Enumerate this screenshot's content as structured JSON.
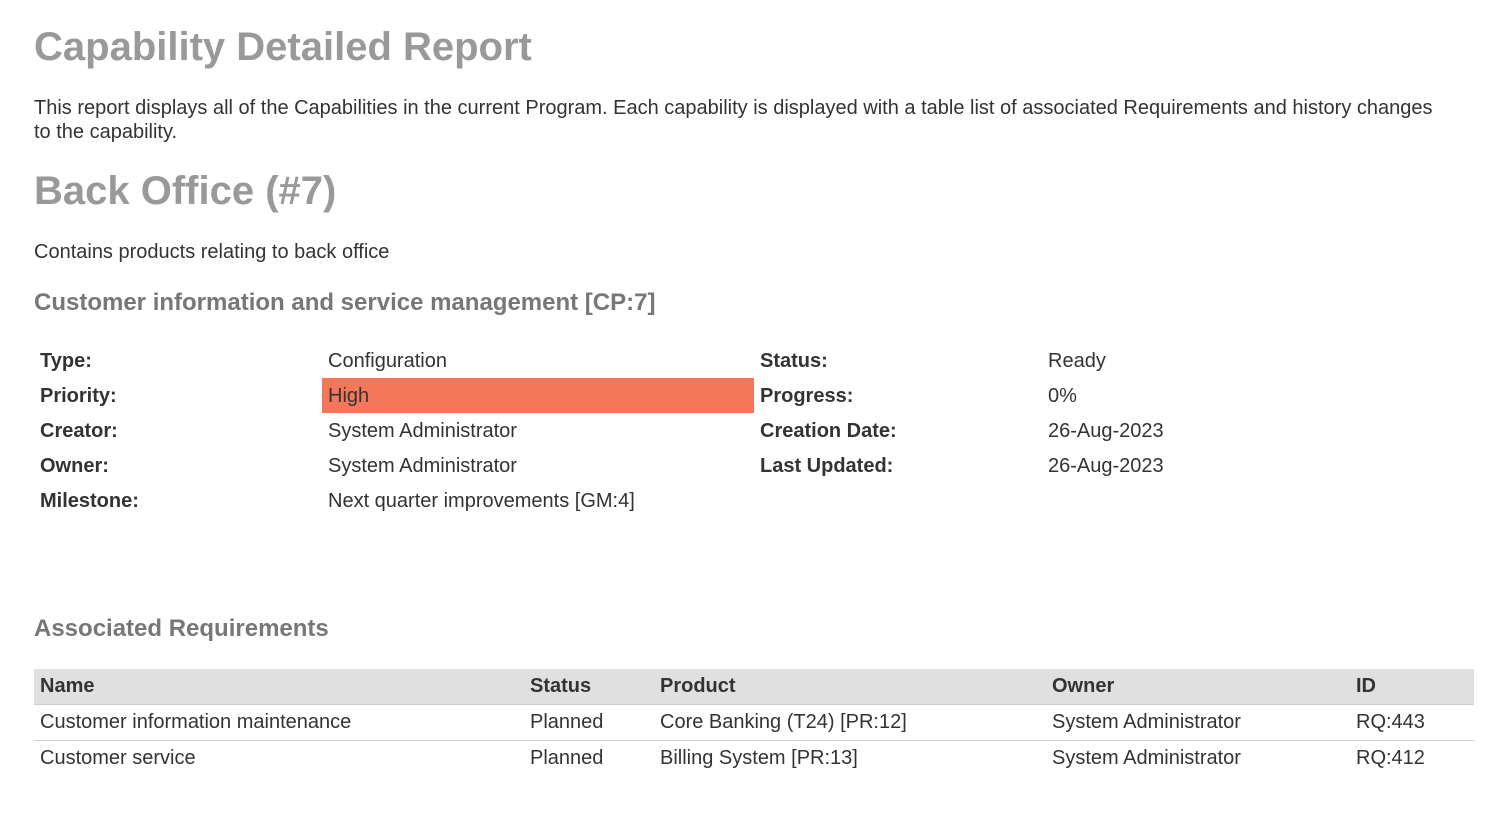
{
  "report": {
    "title": "Capability Detailed Report",
    "description": "This report displays all of the Capabilities in the current Program. Each capability is displayed with a table list of associated Requirements and history changes to the capability."
  },
  "folder": {
    "title": "Back Office (#7)",
    "description": "Contains products relating to back office"
  },
  "capability": {
    "title": "Customer information and service management [CP:7]",
    "properties": {
      "type_label": "Type:",
      "type_value": "Configuration",
      "status_label": "Status:",
      "status_value": "Ready",
      "priority_label": "Priority:",
      "priority_value": "High",
      "priority_color": "#f4775a",
      "progress_label": "Progress:",
      "progress_value": "0%",
      "creator_label": "Creator:",
      "creator_value": "System Administrator",
      "creation_date_label": "Creation Date:",
      "creation_date_value": "26-Aug-2023",
      "owner_label": "Owner:",
      "owner_value": "System Administrator",
      "last_updated_label": "Last Updated:",
      "last_updated_value": "26-Aug-2023",
      "milestone_label": "Milestone:",
      "milestone_value": "Next quarter improvements [GM:4]"
    }
  },
  "requirements": {
    "title": "Associated Requirements",
    "columns": [
      "Name",
      "Status",
      "Product",
      "Owner",
      "ID"
    ],
    "rows": [
      [
        "Customer information maintenance",
        "Planned",
        "Core Banking (T24) [PR:12]",
        "System Administrator",
        "RQ:443"
      ],
      [
        "Customer service",
        "Planned",
        "Billing System [PR:13]",
        "System Administrator",
        "RQ:412"
      ]
    ]
  }
}
